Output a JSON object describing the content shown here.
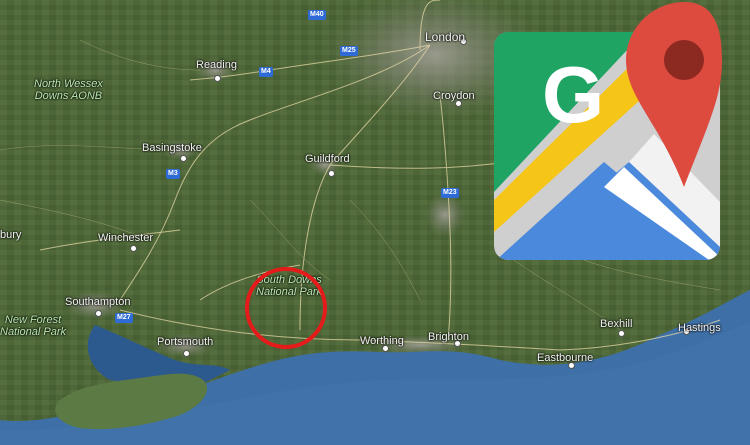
{
  "places": {
    "london": "London",
    "reading": "Reading",
    "croydon": "Croydon",
    "basingstoke": "Basingstoke",
    "guildford": "Guildford",
    "winchester": "Winchester",
    "southampton": "Southampton",
    "portsmouth": "Portsmouth",
    "worthing": "Worthing",
    "brighton": "Brighton",
    "eastbourne": "Eastbourne",
    "bexhill": "Bexhill",
    "hastings": "Hastings",
    "bury": "bury"
  },
  "parks": {
    "north_wessex_line1": "North Wessex",
    "north_wessex_line2": "Downs AONB",
    "new_forest_line1": "New Forest",
    "new_forest_line2": "National Park",
    "south_downs_line1": "South Downs",
    "south_downs_line2": "National Park"
  },
  "roads": {
    "m40": "M40",
    "m25": "M25",
    "m4": "M4",
    "m3": "M3",
    "m23": "M23",
    "m27": "M27"
  },
  "logo": {
    "letter": "G",
    "icon": "google-maps-logo"
  },
  "highlight": {
    "color": "#e51b1b",
    "target": "South Downs National Park"
  },
  "colors": {
    "land": "#4f6a3a",
    "sea": "#3d6fa8",
    "urban": "#8f8f86"
  }
}
